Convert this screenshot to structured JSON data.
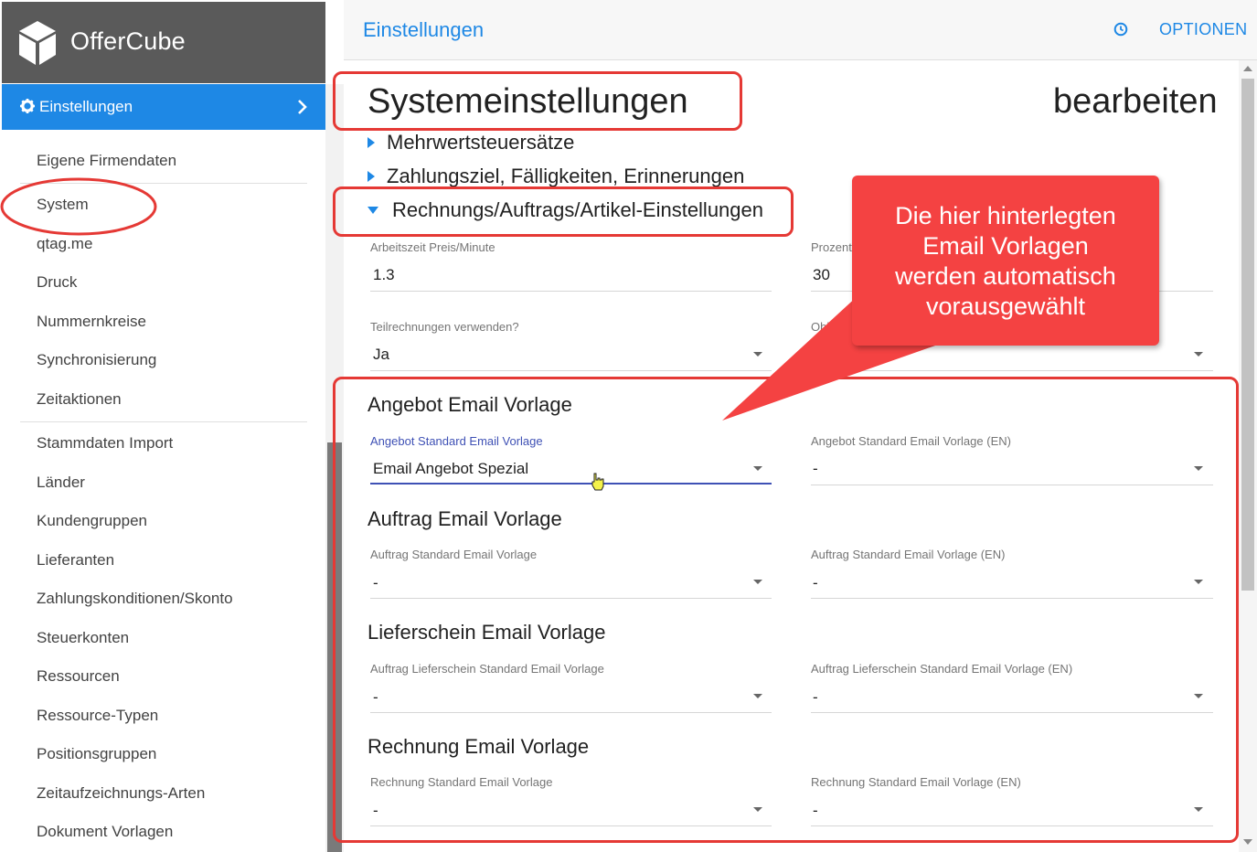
{
  "app": {
    "name": "OfferCube"
  },
  "sidebar": {
    "active": {
      "label": "Einstellungen"
    },
    "items": [
      {
        "label": "Eigene Firmendaten"
      },
      {
        "label": "System"
      },
      {
        "label": "qtag.me"
      },
      {
        "label": "Druck"
      },
      {
        "label": "Nummernkreise"
      },
      {
        "label": "Synchronisierung"
      },
      {
        "label": "Zeitaktionen"
      },
      {
        "label": "Stammdaten Import"
      },
      {
        "label": "Länder"
      },
      {
        "label": "Kundengruppen"
      },
      {
        "label": "Lieferanten"
      },
      {
        "label": "Zahlungskonditionen/Skonto"
      },
      {
        "label": "Steuerkonten"
      },
      {
        "label": "Ressourcen"
      },
      {
        "label": "Ressource-Typen"
      },
      {
        "label": "Positionsgruppen"
      },
      {
        "label": "Zeitaufzeichnungs-Arten"
      },
      {
        "label": "Dokument Vorlagen"
      }
    ]
  },
  "topbar": {
    "title": "Einstellungen",
    "options_label": "OPTIONEN"
  },
  "page": {
    "title": "Systemeinstellungen",
    "right_label": "bearbeiten",
    "sections": [
      {
        "label": "Mehrwertsteuersätze",
        "expanded": false
      },
      {
        "label": "Zahlungsziel, Fälligkeiten, Erinnerungen",
        "expanded": false
      },
      {
        "label": "Rechnungs/Auftrags/Artikel-Einstellungen",
        "expanded": true
      }
    ],
    "fields": {
      "arbeitszeit": {
        "label": "Arbeitszeit Preis/Minute",
        "value": "1.3"
      },
      "prozent": {
        "label": "Prozent",
        "value": "30"
      },
      "teilrechnungen": {
        "label": "Teilrechnungen verwenden?",
        "value": "Ja"
      },
      "objekt": {
        "label": "Objekt",
        "value": ""
      }
    },
    "groups": [
      {
        "title": "Angebot Email Vorlage",
        "left_label": "Angebot Standard Email Vorlage",
        "left_value": "Email Angebot Spezial",
        "right_label": "Angebot Standard Email Vorlage (EN)",
        "right_value": "-"
      },
      {
        "title": "Auftrag Email Vorlage",
        "left_label": "Auftrag Standard Email Vorlage",
        "left_value": "-",
        "right_label": "Auftrag Standard Email Vorlage (EN)",
        "right_value": "-"
      },
      {
        "title": "Lieferschein Email Vorlage",
        "left_label": "Auftrag Lieferschein Standard Email Vorlage",
        "left_value": "-",
        "right_label": "Auftrag Lieferschein Standard Email Vorlage (EN)",
        "right_value": "-"
      },
      {
        "title": "Rechnung Email Vorlage",
        "left_label": "Rechnung Standard Email Vorlage",
        "left_value": "-",
        "right_label": "Rechnung Standard Email Vorlage (EN)",
        "right_value": "-"
      }
    ]
  },
  "callout": {
    "lines": [
      "Die hier hinterlegten",
      "Email Vorlagen",
      "werden automatisch",
      "vorausgewählt"
    ]
  },
  "colors": {
    "accent": "#1e88e5",
    "header_dark": "#5a5a5a",
    "annotation_red": "#e53935",
    "callout_red": "#f44242",
    "focus": "#3f51b5"
  }
}
